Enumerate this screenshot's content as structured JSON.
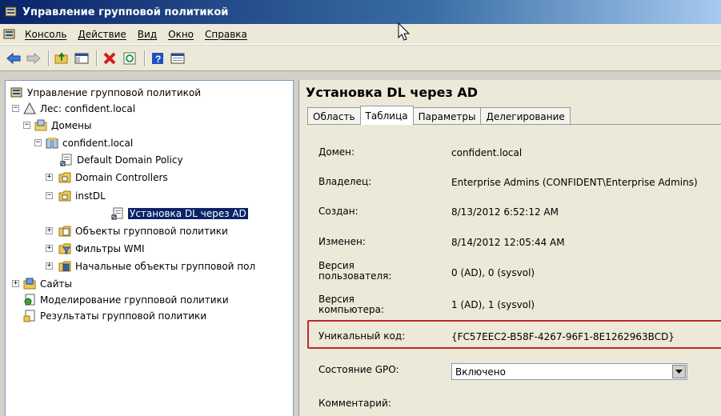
{
  "window": {
    "title": "Управление групповой политикой"
  },
  "menu": {
    "items": [
      "Консоль",
      "Действие",
      "Вид",
      "Окно",
      "Справка"
    ]
  },
  "toolbar": {
    "buttons": [
      "back-icon",
      "forward-icon",
      "up-folder-icon",
      "show-hide-tree-icon",
      "delete-icon",
      "refresh-icon",
      "help-icon",
      "properties-icon"
    ]
  },
  "tree": {
    "root": "Управление групповой политикой",
    "forest": "Лес: confident.local",
    "domains": "Домены",
    "domain": "confident.local",
    "default_policy": "Default Domain Policy",
    "domain_controllers": "Domain Controllers",
    "instdl": "instDL",
    "selected_gpo": "Установка DL через AD",
    "gpo_objects": "Объекты групповой политики",
    "wmi_filters": "Фильтры WMI",
    "starter_gpos": "Начальные объекты групповой пол",
    "sites": "Сайты",
    "modeling": "Моделирование групповой политики",
    "results": "Результаты групповой политики"
  },
  "detail": {
    "title": "Установка DL через AD",
    "tabs": [
      "Область",
      "Таблица",
      "Параметры",
      "Делегирование"
    ],
    "active_tab": "Таблица",
    "rows": {
      "domain": {
        "label": "Домен:",
        "value": "confident.local"
      },
      "owner": {
        "label": "Владелец:",
        "value": "Enterprise Admins (CONFIDENT\\Enterprise Admins)"
      },
      "created": {
        "label": "Создан:",
        "value": "8/13/2012 6:52:12 AM"
      },
      "modified": {
        "label": "Изменен:",
        "value": "8/14/2012 12:05:44 AM"
      },
      "user_version": {
        "label_line1": "Версия",
        "label_line2": "пользователя:",
        "value": "0 (AD), 0 (sysvol)"
      },
      "computer_version": {
        "label_line1": "Версия",
        "label_line2": "компьютера:",
        "value": "1 (AD), 1 (sysvol)"
      },
      "unique_id": {
        "label": "Уникальный код:",
        "value": "{FC57EEC2-B58F-4267-96F1-8E1262963BCD}"
      },
      "gpo_status": {
        "label": "Состояние GPO:",
        "value": "Включено"
      },
      "comment": {
        "label": "Комментарий:"
      }
    }
  },
  "colors": {
    "titlebar": "#0a246a",
    "highlight": "#c0282d",
    "selection": "#0a246a"
  }
}
